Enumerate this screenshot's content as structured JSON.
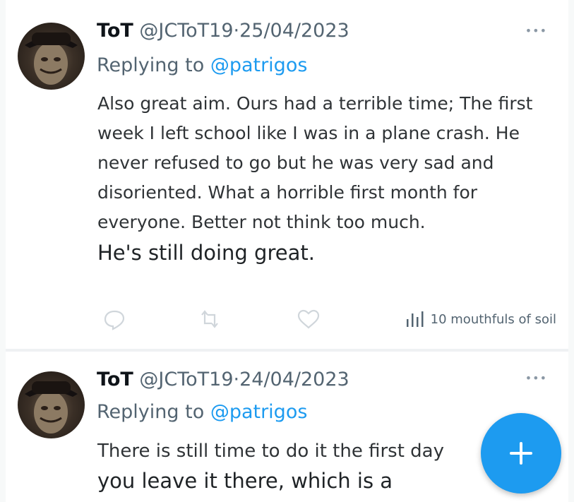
{
  "tweets": [
    {
      "display_name": "ToT",
      "handle": "@JCToT19",
      "separator": "·",
      "date": "25/04/2023",
      "replying_prefix": "Replying to",
      "replying_handle": "@patrigos",
      "body": "Also great aim. Ours had a terrible time; The first week I left school like I was in a plane crash. He never refused to go but he was very sad and disoriented. What a horrible first month for everyone. Better not think too much.",
      "body_large": "He's still doing great.",
      "views": "10 mouthfuls of soil",
      "more_icon": "more-icon"
    },
    {
      "display_name": "ToT",
      "handle": "@JCToT19",
      "separator": "·",
      "date": "24/04/2023",
      "replying_prefix": "Replying to",
      "replying_handle": "@patrigos",
      "body": "There is still time to do it the first day",
      "body_large": "you leave it there, which is a"
    }
  ],
  "colors": {
    "accent": "#1d9bf0",
    "text_primary": "#0f1419",
    "text_secondary": "#536471",
    "divider": "#eff1f3"
  },
  "icons": {
    "reply": "reply-icon",
    "retweet": "retweet-icon",
    "like": "heart-icon",
    "views": "bar-chart-icon",
    "compose": "plus-icon"
  }
}
